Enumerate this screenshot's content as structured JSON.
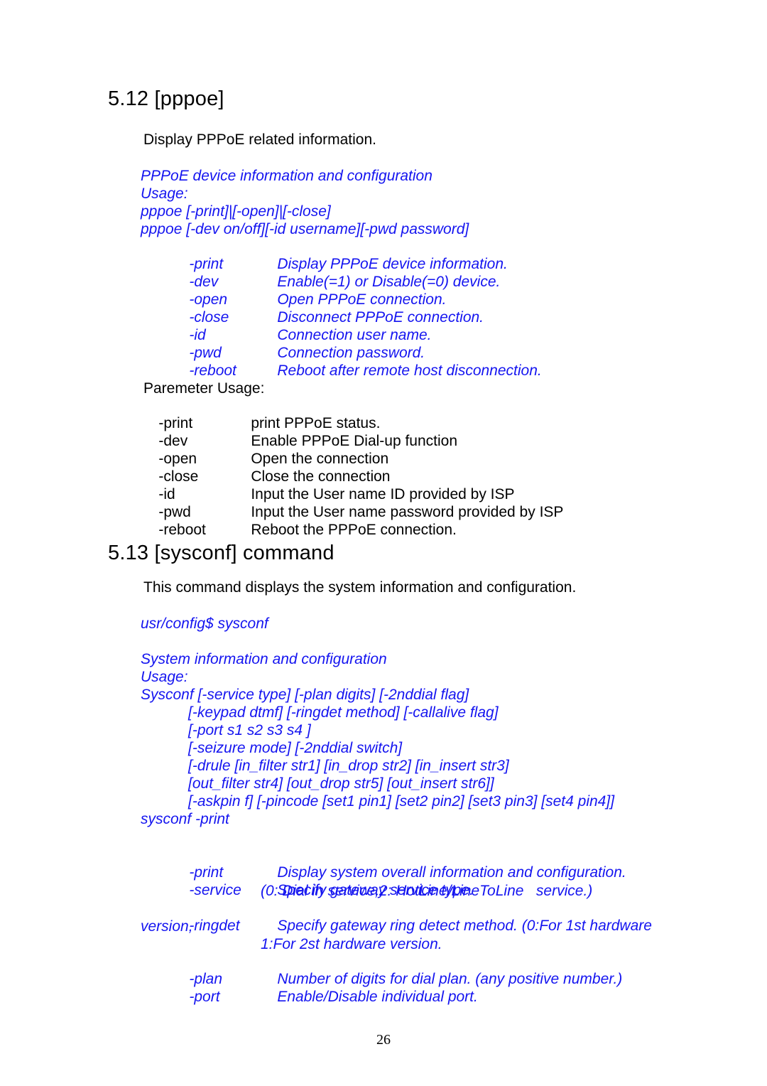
{
  "document": {
    "page_number": "26",
    "accent_color": "#1414f0",
    "text_color": "#000000"
  },
  "section_pppoe": {
    "heading": "5.12 [pppoe]",
    "intro": "Display PPPoE related information.",
    "usage_block": {
      "title": "PPPoE device information and configuration",
      "usage_label": "Usage:",
      "syntax_lines": [
        "pppoe [-print]|[-open]|[-close]",
        "pppoe [-dev on/off][-id username][-pwd password]"
      ],
      "options": [
        {
          "flag": "-print",
          "desc": "Display PPPoE device information."
        },
        {
          "flag": "-dev",
          "desc": "Enable(=1) or Disable(=0) device."
        },
        {
          "flag": "-open",
          "desc": "Open PPPoE connection."
        },
        {
          "flag": "-close",
          "desc": "Disconnect PPPoE connection."
        },
        {
          "flag": "-id",
          "desc": "Connection user name."
        },
        {
          "flag": "-pwd",
          "desc": "Connection password."
        },
        {
          "flag": "-reboot",
          "desc": "Reboot after remote host disconnection."
        }
      ]
    },
    "parameter_usage": {
      "title": "Paremeter Usage:",
      "options": [
        {
          "flag": "-print",
          "desc": "print PPPoE status."
        },
        {
          "flag": "-dev",
          "desc": "Enable PPPoE Dial-up function"
        },
        {
          "flag": "-open",
          "desc": "Open the connection"
        },
        {
          "flag": "-close",
          "desc": "Close the connection"
        },
        {
          "flag": "-id",
          "desc": "Input the User name ID provided by ISP"
        },
        {
          "flag": "-pwd",
          "desc": "Input the User name password provided by ISP"
        },
        {
          "flag": "-reboot",
          "desc": "Reboot the PPPoE connection."
        }
      ]
    }
  },
  "section_sysconf": {
    "heading": "5.13 [sysconf] command",
    "intro": "This command displays the system information and configuration.",
    "prompt": "usr/config$ sysconf",
    "usage_block": {
      "title": "System information and configuration",
      "usage_label": "Usage:",
      "syntax_first": "Sysconf [-service type] [-plan digits] [-2nddial flag]",
      "syntax_indented": [
        "[-keypad dtmf] [-ringdet method] [-callalive flag]",
        "[-port s1 s2 s3 s4 ]",
        "[-seizure mode] [-2nddial switch]",
        "[-drule [in_filter str1] [in_drop str2] [in_insert str3]",
        "[out_filter str4] [out_drop str5] [out_insert str6]]",
        "[-askpin f] [-pincode [set1 pin1] [set2 pin2] [set3 pin3] [set4 pin4]]"
      ],
      "syntax_last": "sysconf -print"
    },
    "options": {
      "print": {
        "flag": "-print",
        "desc": "Display system overall information and configuration."
      },
      "service": {
        "flag": "-service",
        "desc": "Specify gateway service type."
      },
      "service_note": "(0: Dial in service,2: HotLine/LineToLine   service.)",
      "ringdet": {
        "flag": "-ringdet",
        "desc": "Specify gateway ring detect method. (0:For 1st hardware"
      },
      "ringdet_wrap": "version,",
      "ringdet_note": "1:For 2st hardware version.",
      "plan": {
        "flag": "-plan",
        "desc": "Number of digits for dial plan. (any positive number.)"
      },
      "port": {
        "flag": "-port",
        "desc": "Enable/Disable individual port."
      }
    }
  }
}
